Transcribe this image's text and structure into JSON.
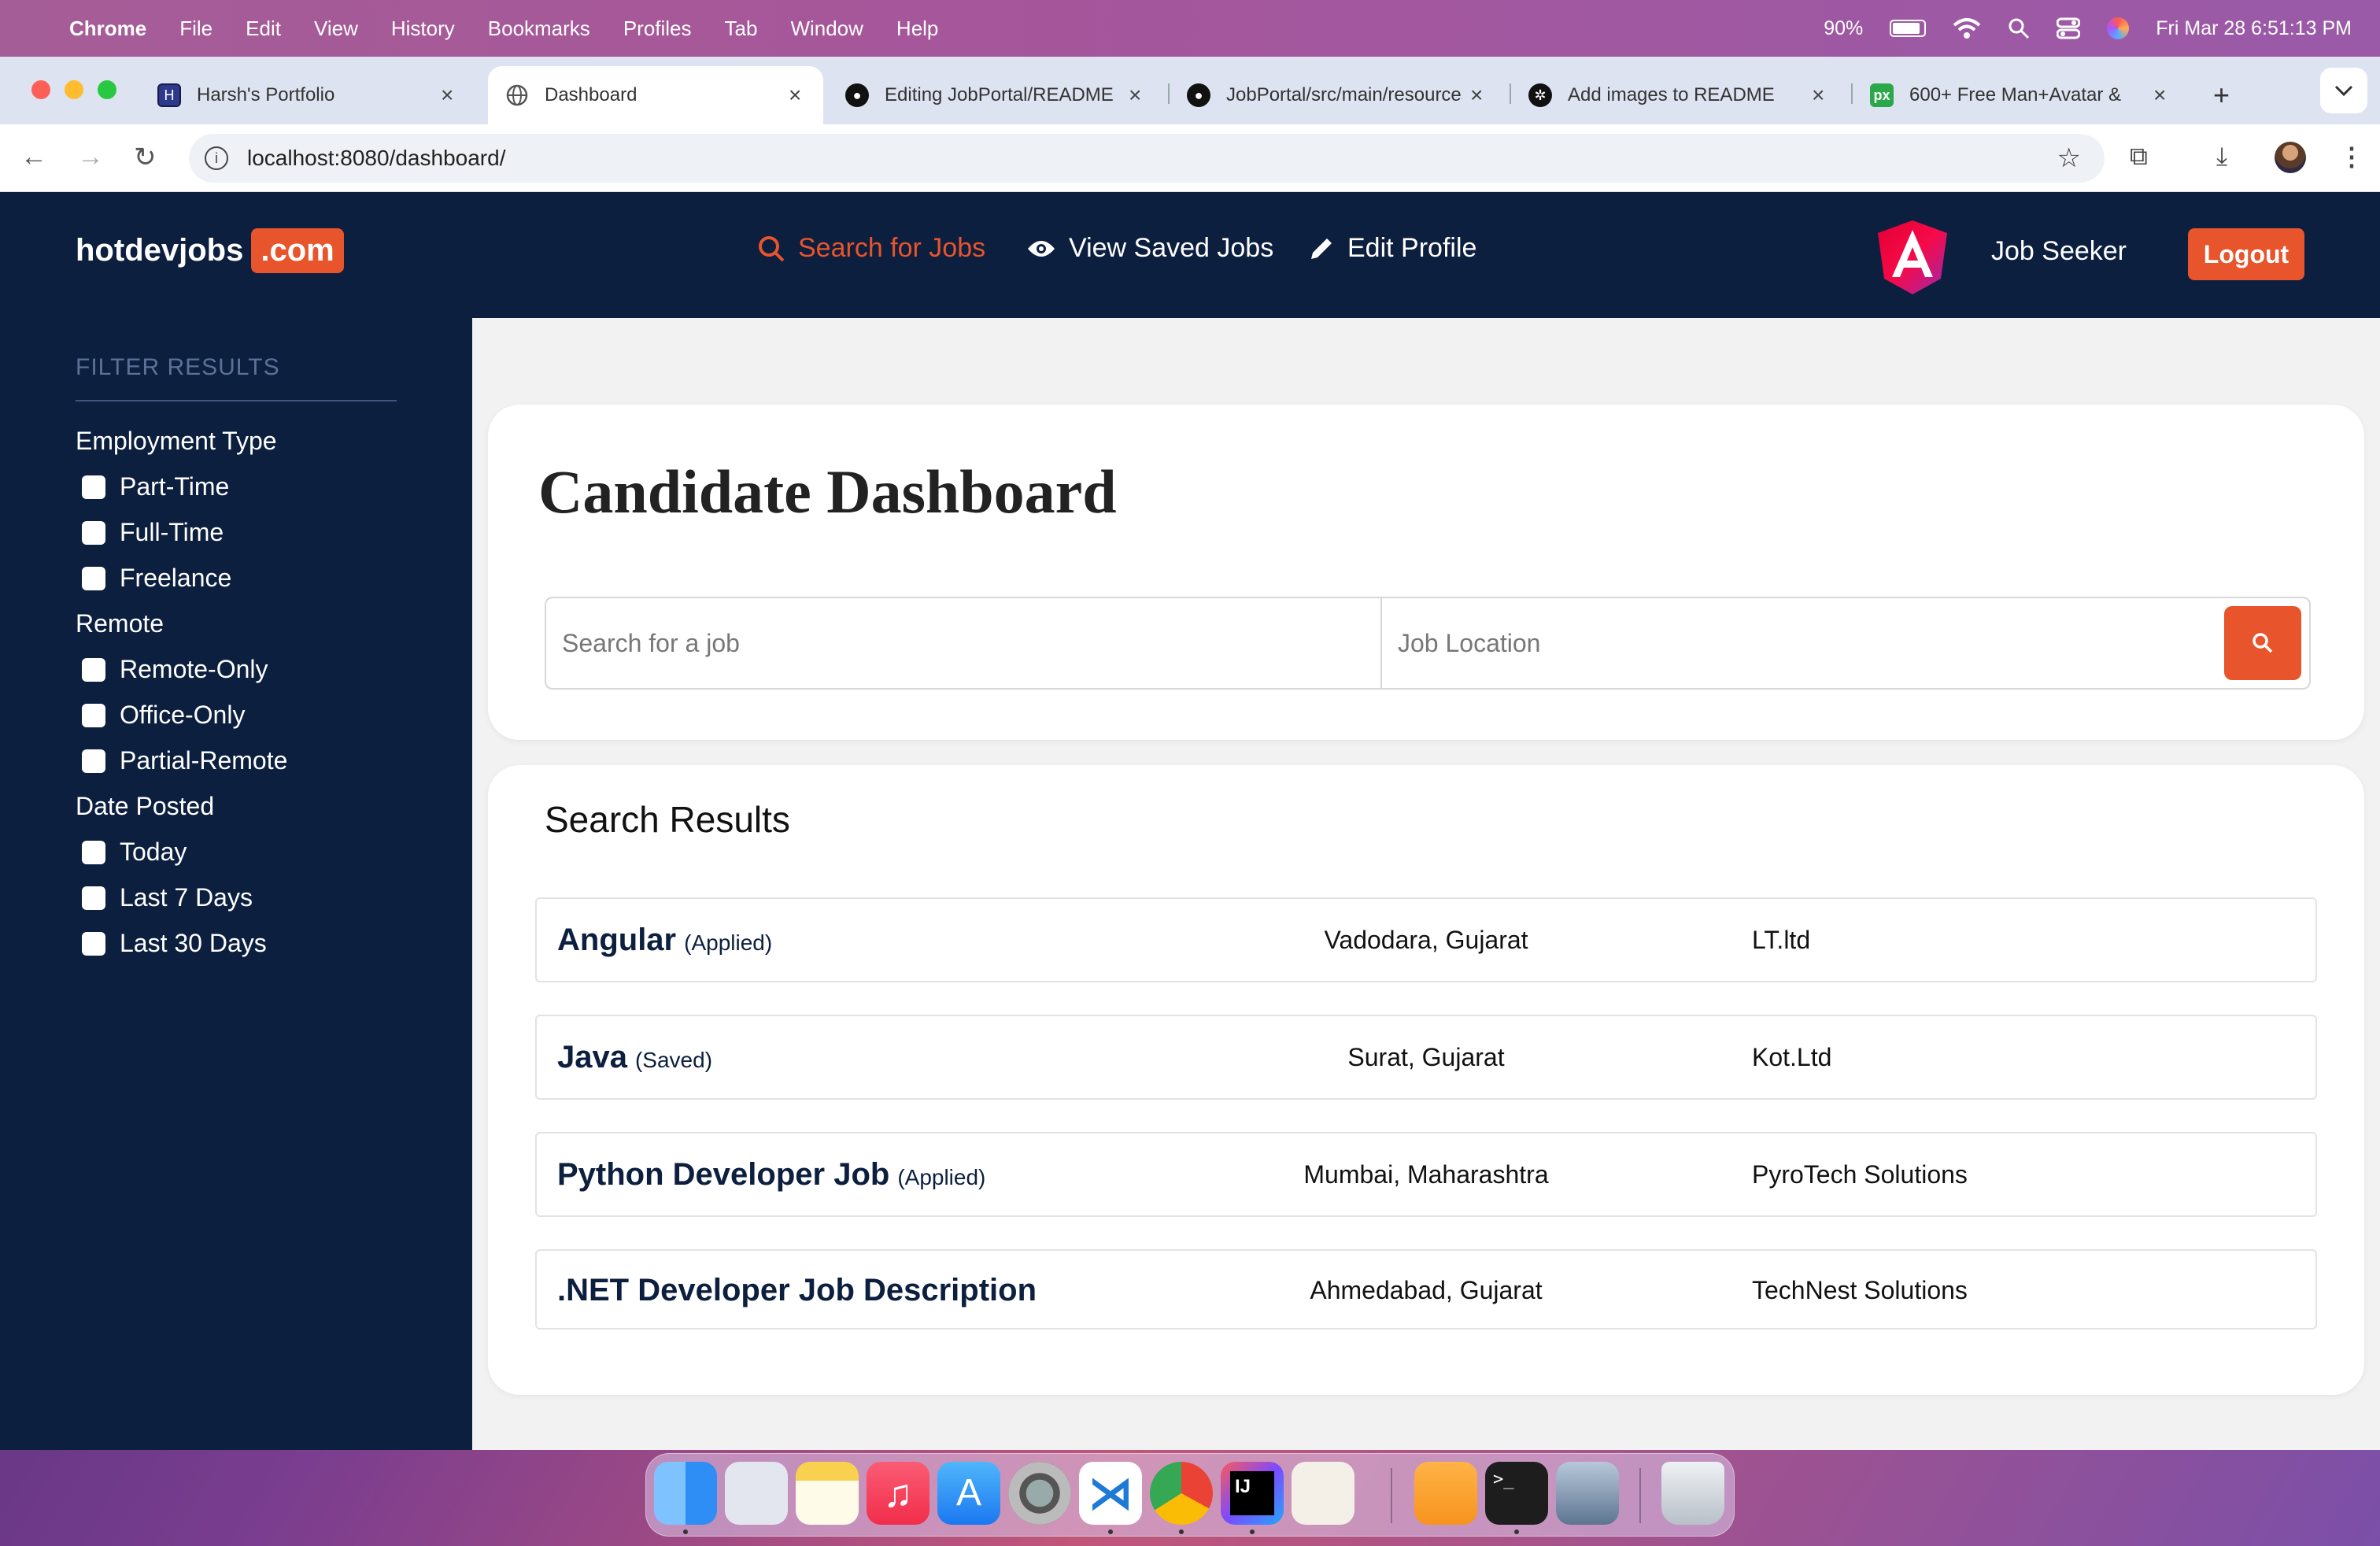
{
  "menubar": {
    "app": "Chrome",
    "items": [
      "File",
      "Edit",
      "View",
      "History",
      "Bookmarks",
      "Profiles",
      "Tab",
      "Window",
      "Help"
    ],
    "battery": "90%",
    "datetime": "Fri Mar 28  6:51:13 PM"
  },
  "browser": {
    "tabs": [
      {
        "title": "Harsh's Portfolio",
        "icon": "portfolio-icon"
      },
      {
        "title": "Dashboard",
        "icon": "globe-icon"
      },
      {
        "title": "Editing JobPortal/README",
        "icon": "github-icon"
      },
      {
        "title": "JobPortal/src/main/resources",
        "icon": "github-icon"
      },
      {
        "title": "Add images to README",
        "icon": "openai-icon"
      },
      {
        "title": "600+ Free Man+Avatar &",
        "icon": "pixabay-icon"
      }
    ],
    "url": "localhost:8080/dashboard/"
  },
  "site": {
    "logo_main": "hotdevjobs",
    "logo_suffix": ".com",
    "nav": {
      "search": "Search for Jobs",
      "saved": "View Saved Jobs",
      "edit": "Edit Profile"
    },
    "role": "Job Seeker",
    "logout": "Logout"
  },
  "filters": {
    "title": "FILTER RESULTS",
    "employment_type": "Employment Type",
    "employment_options": [
      "Part-Time",
      "Full-Time",
      "Freelance"
    ],
    "remote": "Remote",
    "remote_options": [
      "Remote-Only",
      "Office-Only",
      "Partial-Remote"
    ],
    "date_posted": "Date Posted",
    "date_options": [
      "Today",
      "Last 7 Days",
      "Last 30 Days"
    ]
  },
  "dashboard": {
    "title": "Candidate Dashboard",
    "job_placeholder": "Search for a job",
    "location_placeholder": "Job Location"
  },
  "results": {
    "title": "Search Results",
    "jobs": [
      {
        "title": "Angular",
        "status": "(Applied)",
        "location": "Vadodara, Gujarat",
        "company": "LT.ltd"
      },
      {
        "title": "Java",
        "status": "(Saved)",
        "location": "Surat, Gujarat",
        "company": "Kot.Ltd"
      },
      {
        "title": "Python Developer Job",
        "status": "(Applied)",
        "location": "Mumbai, Maharashtra",
        "company": "PyroTech Solutions"
      },
      {
        "title": ".NET Developer Job Description",
        "status": "",
        "location": "Ahmedabad, Gujarat",
        "company": "TechNest Solutions"
      }
    ]
  },
  "colors": {
    "accent": "#e8542b",
    "navy": "#0c1f3f"
  },
  "dock": [
    "finder-icon",
    "launchpad-icon",
    "notes-icon",
    "music-icon",
    "app-store-icon",
    "system-settings-icon",
    "vscode-icon",
    "chrome-icon",
    "intellij-icon",
    "pgadmin-icon",
    "pages-icon",
    "terminal-icon",
    "preview-icon",
    "trash-icon"
  ]
}
